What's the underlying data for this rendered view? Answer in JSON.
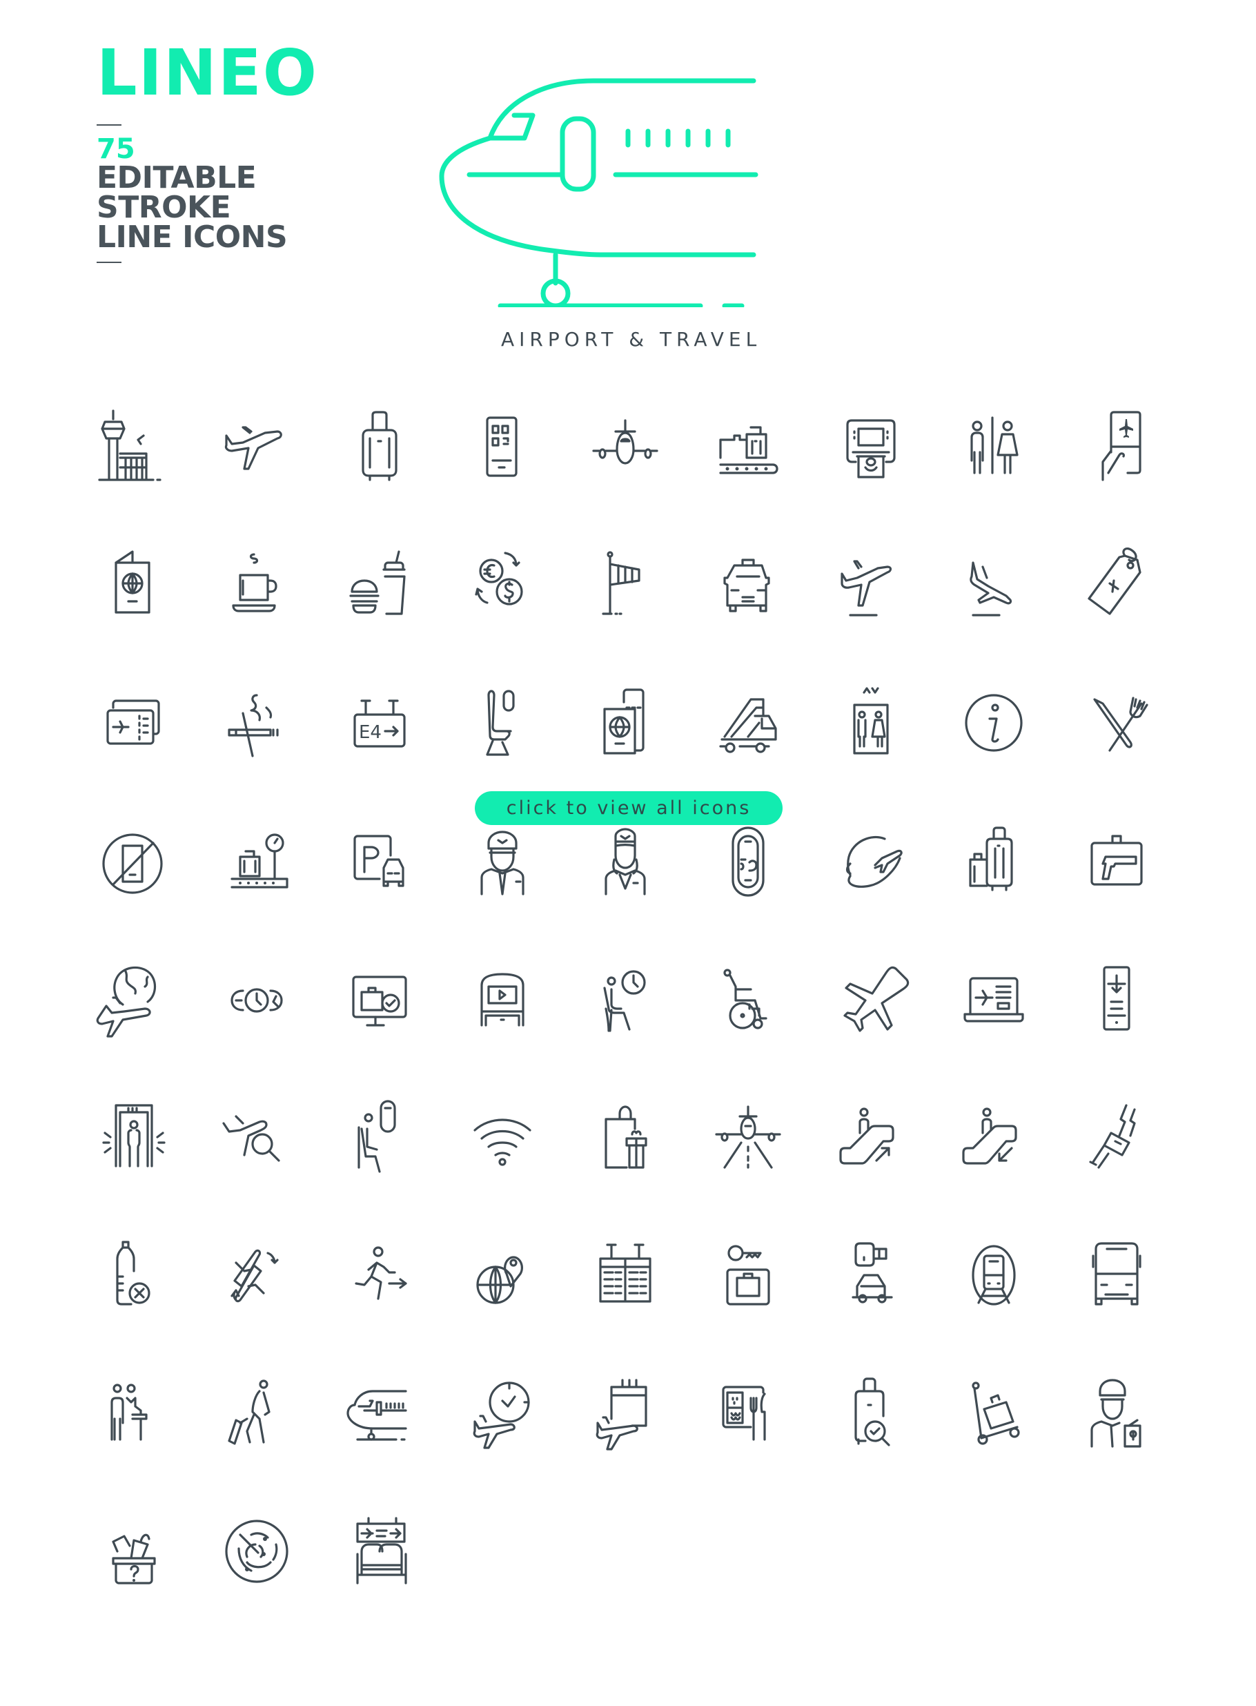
{
  "brand": {
    "title": "LINEO",
    "count": "75",
    "tagline_lines": [
      "EDITABLE",
      "STROKE",
      "LINE ICONS"
    ]
  },
  "hero": {
    "subtitle": "AIRPORT & TRAVEL",
    "icon": "airplane-nose-icon"
  },
  "cta": {
    "label": "click to view all icons"
  },
  "colors": {
    "accent": "#12ecb0",
    "ink": "#3f4a52",
    "background": "#ffffff"
  },
  "icons": [
    "control-tower",
    "airplane-takeoff",
    "rolling-suitcase",
    "mobile-boarding-pass",
    "airplane-front",
    "baggage-conveyor",
    "atm",
    "restroom",
    "boarding-pass-hand",
    "passport",
    "coffee-cup",
    "fast-food",
    "currency-exchange",
    "windsock",
    "taxi",
    "departure",
    "arrival",
    "luggage-tag",
    "flight-tickets",
    "no-smoking",
    "gate-sign",
    "airplane-seat",
    "passport-ticket",
    "airstairs-truck",
    "elevator",
    "information",
    "restaurant",
    "no-phone",
    "baggage-scale",
    "parking",
    "pilot",
    "flight-attendant",
    "airplane-window",
    "world-flight",
    "luggage",
    "gun-case",
    "global-travel",
    "world-clocks",
    "baggage-check-monitor",
    "seat-entertainment",
    "waiting-room",
    "wheelchair",
    "airplane",
    "online-check-in",
    "mobile-ticket",
    "security-scanner",
    "flight-search",
    "window-seat",
    "wifi",
    "duty-free-shopping",
    "runway",
    "escalator-up",
    "escalator-down",
    "seat-belt",
    "no-liquids",
    "connecting-flight",
    "exit",
    "destination",
    "flight-board",
    "locker",
    "car-rental",
    "train",
    "bus",
    "check-in-desk",
    "traveler",
    "airplane-side",
    "on-time-flight",
    "flight-schedule",
    "in-flight-meal",
    "baggage-inspection",
    "baggage-cart",
    "customs-officer",
    "lost-and-found",
    "radar",
    "departure-lounge"
  ],
  "gate_sign_text": "E4"
}
